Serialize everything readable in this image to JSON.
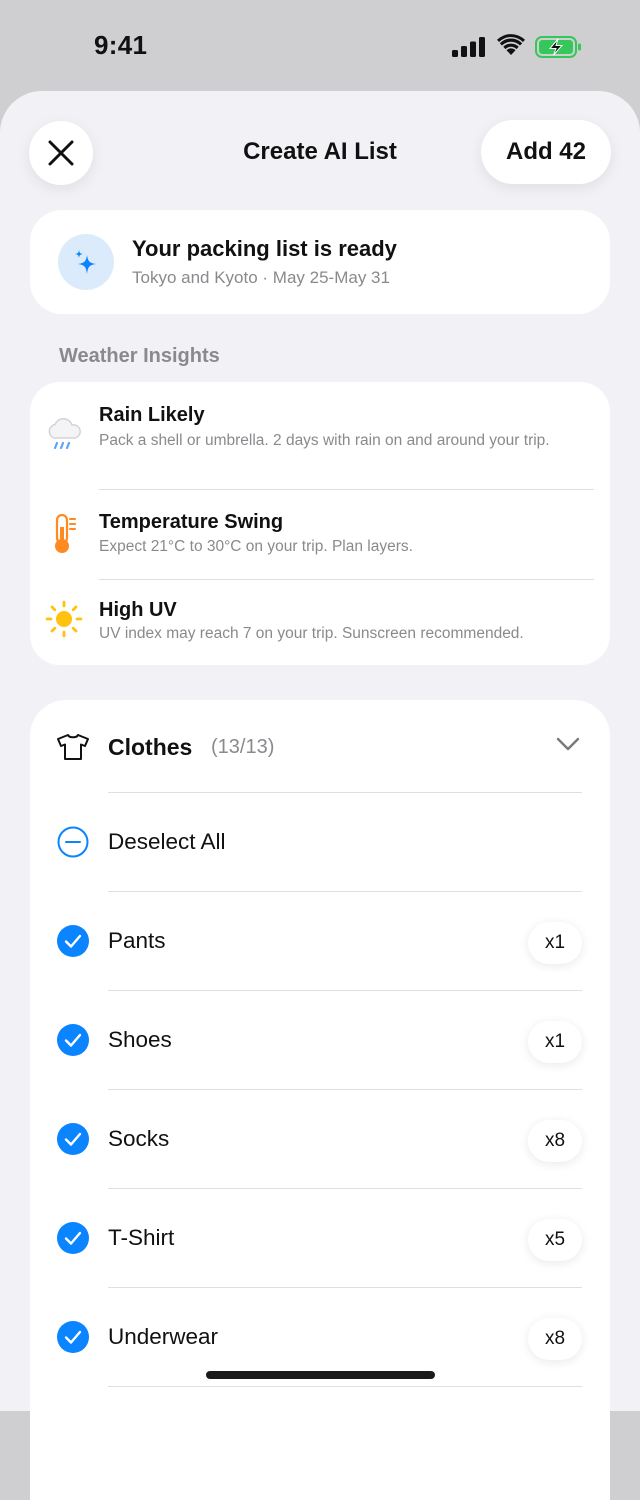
{
  "status_bar": {
    "time": "9:41",
    "icons": [
      "cellular-signal-icon",
      "wifi-icon",
      "battery-charging-icon"
    ],
    "battery_color": "#34c759"
  },
  "header": {
    "title": "Create AI List",
    "add_label": "Add 42",
    "close_icon": "close-icon"
  },
  "ready_card": {
    "title": "Your packing list is ready",
    "subtitle": "Tokyo and Kyoto · May 25-May 31",
    "icon": "sparkles-icon"
  },
  "weather": {
    "heading": "Weather Insights",
    "items": [
      {
        "icon": "rain-cloud-icon",
        "title": "Rain Likely",
        "description": "Pack a shell or umbrella. 2 days with rain on and around your trip."
      },
      {
        "icon": "thermometer-icon",
        "title": "Temperature Swing",
        "description": "Expect 21°C to 30°C on your trip. Plan layers."
      },
      {
        "icon": "sun-icon",
        "title": "High UV",
        "description": "UV index may reach 7 on your trip. Sunscreen recommended."
      }
    ]
  },
  "clothes": {
    "title": "Clothes",
    "count": "(13/13)",
    "deselect_label": "Deselect All",
    "items": [
      {
        "label": "Pants",
        "qty": "x1"
      },
      {
        "label": "Shoes",
        "qty": "x1"
      },
      {
        "label": "Socks",
        "qty": "x8"
      },
      {
        "label": "T-Shirt",
        "qty": "x5"
      },
      {
        "label": "Underwear",
        "qty": "x8"
      }
    ]
  },
  "colors": {
    "accent": "#0a84ff",
    "sun": "#ffc20e",
    "thermometer": "#ff8a1f",
    "rain": "#5aa5f5"
  }
}
